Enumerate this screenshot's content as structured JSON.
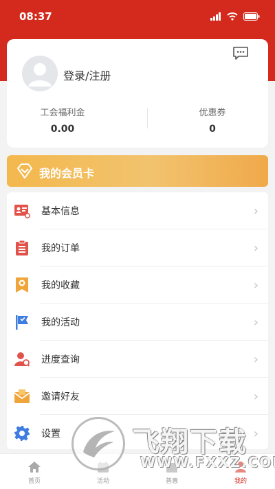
{
  "status_bar": {
    "time": "08:37"
  },
  "profile": {
    "login_label": "登录/注册",
    "stats": [
      {
        "label": "工会福利金",
        "value": "0.00"
      },
      {
        "label": "优惠券",
        "value": "0"
      }
    ]
  },
  "member_card": {
    "label": "我的会员卡"
  },
  "menu": {
    "items": [
      {
        "label": "基本信息",
        "icon": "id-card-icon",
        "color": "#e0524a"
      },
      {
        "label": "我的订单",
        "icon": "clipboard-icon",
        "color": "#e0524a"
      },
      {
        "label": "我的收藏",
        "icon": "bookmark-icon",
        "color": "#f0a53a"
      },
      {
        "label": "我的活动",
        "icon": "flag-icon",
        "color": "#3f7de0"
      },
      {
        "label": "进度查询",
        "icon": "person-search-icon",
        "color": "#e0524a"
      },
      {
        "label": "邀请好友",
        "icon": "envelope-icon",
        "color": "#f0a53a"
      },
      {
        "label": "设置",
        "icon": "gear-icon",
        "color": "#3f7de0"
      }
    ]
  },
  "tab_bar": {
    "tabs": [
      {
        "label": "首页",
        "icon": "home-icon"
      },
      {
        "label": "活动",
        "icon": "activity-icon"
      },
      {
        "label": "普惠",
        "icon": "benefit-icon"
      },
      {
        "label": "我的",
        "icon": "profile-icon"
      }
    ],
    "active_index": 3
  },
  "watermark": {
    "title": "飞翔下载",
    "url": "WWW.FXXZ.COM"
  },
  "colors": {
    "brand_red": "#d42a1e",
    "member_gold": "#f2b44f"
  }
}
